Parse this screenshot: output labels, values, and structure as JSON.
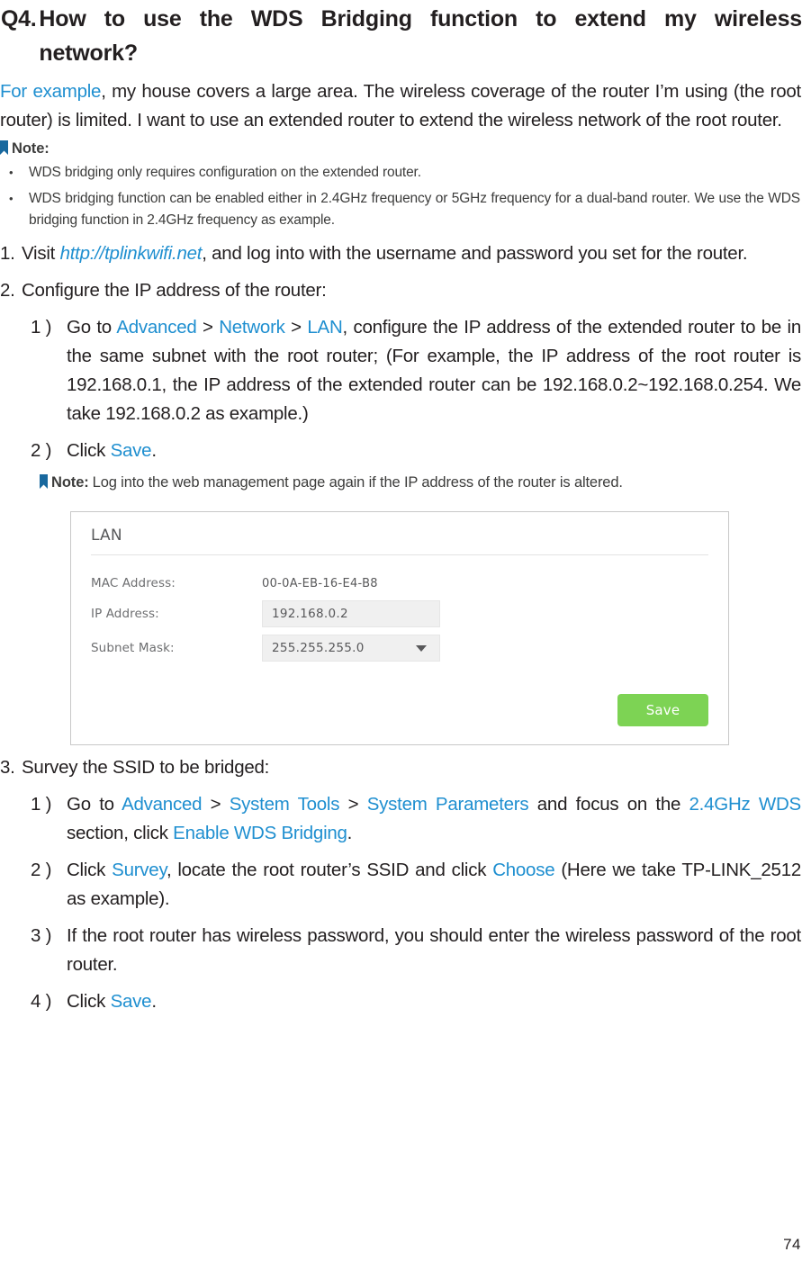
{
  "question": {
    "number": "Q4.",
    "title_line1": "How to use the WDS Bridging function to extend my wireless",
    "title_line2": "network?"
  },
  "intro": {
    "link_text": "For example",
    "rest": ", my house covers a large area. The wireless coverage of the router I’m using (the root router) is limited. I want to use an extended router to extend the wireless network of the root router."
  },
  "note_top": {
    "label": "Note:",
    "icon": "bookmark-icon",
    "bullets": [
      "WDS bridging only requires configuration on the extended router.",
      "WDS bridging function can be enabled either in 2.4GHz frequency or 5GHz frequency for a dual-band router. We use the WDS bridging function in 2.4GHz frequency as example."
    ]
  },
  "steps": {
    "s1": {
      "num": "1.",
      "pre": "Visit ",
      "link": "http://tplinkwifi.net",
      "post": ", and log into with the username and password you set for the router."
    },
    "s2": {
      "num": "2.",
      "text": "Configure the IP address of the router:",
      "sub1": {
        "num": "1 )",
        "t1": "Go to ",
        "l1": "Advanced",
        "t2": " > ",
        "l2": "Network",
        "t3": " > ",
        "l3": "LAN",
        "t4": ", configure the IP address of the extended router to be in the same subnet with the root router; (For example, the IP address of the root router is 192.168.0.1, the IP address of the extended router can be 192.168.0.2~192.168.0.254. We take 192.168.0.2 as example.)"
      },
      "sub2": {
        "num": "2 )",
        "t1": "Click ",
        "l1": "Save",
        "t2": "."
      },
      "note": {
        "label": "Note:",
        "text": "Log into the web management page again if the IP address of the router is altered."
      }
    },
    "s3": {
      "num": "3.",
      "text": "Survey the SSID to be bridged:",
      "sub1": {
        "num": "1 )",
        "t1": "Go to ",
        "l1": "Advanced",
        "t2": " > ",
        "l2": "System Tools",
        "t3": " > ",
        "l3": "System Parameters",
        "t4": " and focus on the ",
        "l4": "2.4GHz WDS",
        "t5": " section, click ",
        "l5": "Enable WDS Bridging",
        "t6": "."
      },
      "sub2": {
        "num": "2 )",
        "t1": "Click ",
        "l1": "Survey",
        "t2": ", locate the root router’s SSID and click ",
        "l2": "Choose",
        "t3": " (Here we take TP-LINK_2512 as example)."
      },
      "sub3": {
        "num": "3 )",
        "text": "If the root router has wireless password, you should enter the wireless password of the root router."
      },
      "sub4": {
        "num": "4 )",
        "t1": "Click ",
        "l1": "Save",
        "t2": "."
      }
    }
  },
  "lan_panel": {
    "title": "LAN",
    "rows": [
      {
        "label": "MAC Address:",
        "value": "00-0A-EB-16-E4-B8",
        "type": "text"
      },
      {
        "label": "IP Address:",
        "value": "192.168.0.2",
        "type": "input"
      },
      {
        "label": "Subnet Mask:",
        "value": "255.255.255.0",
        "type": "select"
      }
    ],
    "mac_label": "MAC Address:",
    "mac_value": "00-0A-EB-16-E4-B8",
    "ip_label": "IP Address:",
    "ip_value": "192.168.0.2",
    "mask_label": "Subnet Mask:",
    "mask_value": "255.255.255.0",
    "save_label": "Save",
    "accent_green": "#7dd354",
    "caret_icon": "chevron-down-icon"
  },
  "footer": {
    "page_number": "74"
  },
  "colors": {
    "link_blue": "#1f8fd0",
    "note_blue": "#18689e",
    "text": "#231f20"
  }
}
